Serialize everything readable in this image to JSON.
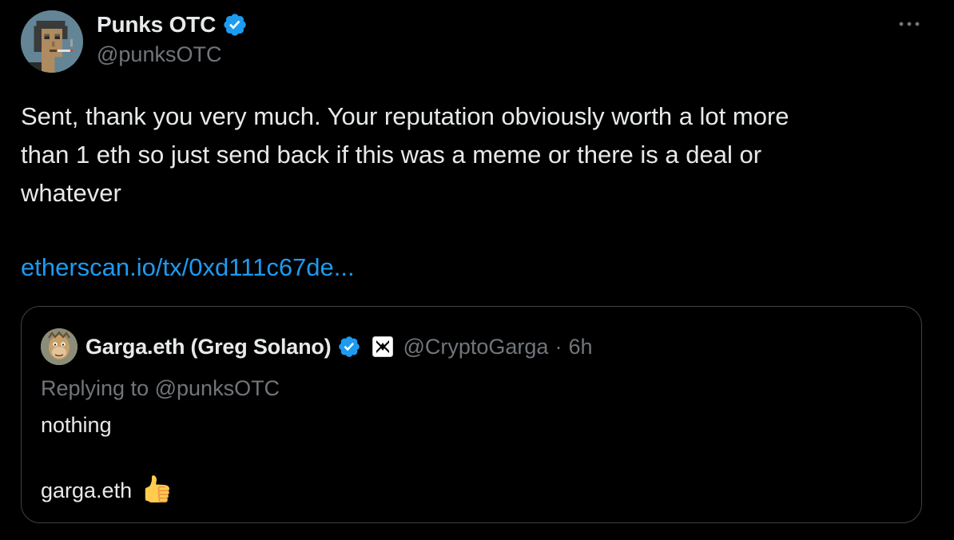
{
  "tweet": {
    "author": {
      "name": "Punks OTC",
      "handle": "@punksOTC",
      "verified": true,
      "avatar_icon": "cryptopunk-avatar"
    },
    "more_icon": "ellipsis-icon",
    "text": "Sent, thank you very much. Your reputation obviously worth a lot more\nthan 1 eth so just send back if this was a meme or there is a deal or\nwhatever",
    "link": "etherscan.io/tx/0xd111c67de..."
  },
  "quote": {
    "author": {
      "name": "Garga.eth (Greg Solano)",
      "handle": "@CryptoGarga",
      "verified": true,
      "affiliate_badge_icon": "yuga-labs-badge-icon",
      "avatar_icon": "bored-ape-avatar"
    },
    "separator": "·",
    "time": "6h",
    "replying_prefix": "Replying to",
    "replying_to": "@punksOTC",
    "line1": "nothing",
    "line2": "garga.eth",
    "emoji_icon": "thumbs-up-icon"
  },
  "colors": {
    "background": "#000000",
    "text": "#e7e9ea",
    "secondary": "#71767b",
    "link": "#1d9bf0",
    "verified": "#1d9bf0",
    "border": "#3e4144"
  }
}
